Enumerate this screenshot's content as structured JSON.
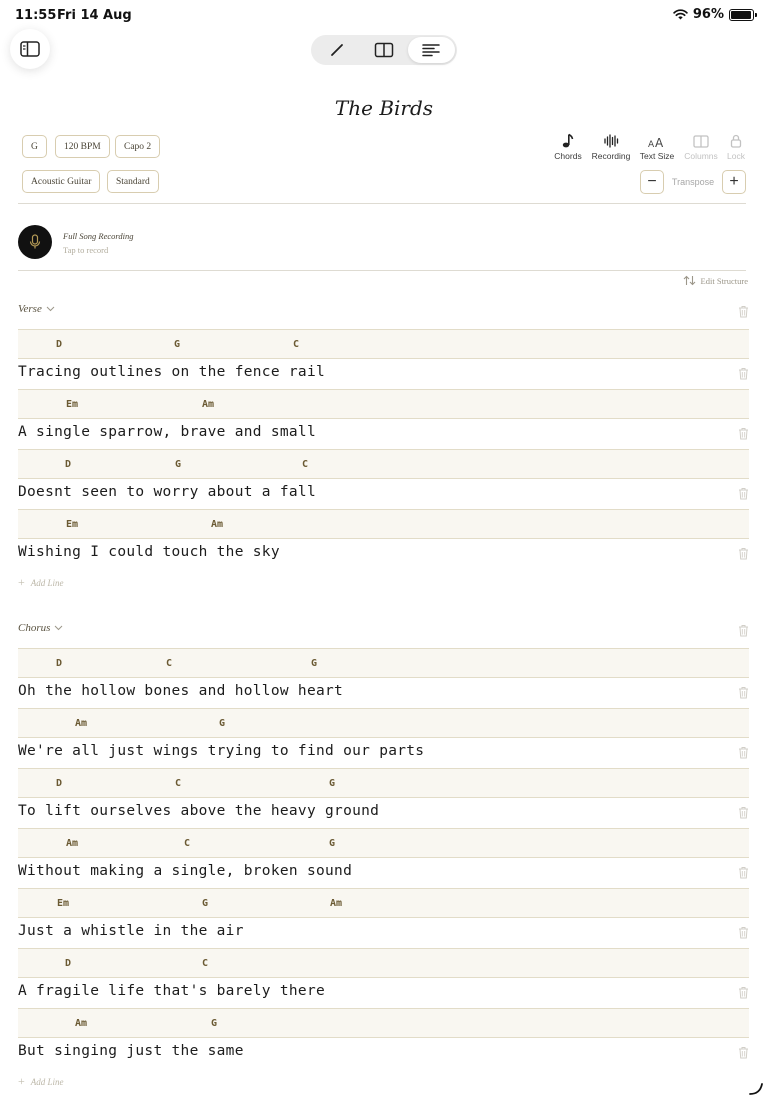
{
  "status_bar": {
    "time": "11:55",
    "date": "Fri 14 Aug",
    "battery": "96%",
    "battery_level": 0.96
  },
  "song": {
    "title": "The Birds"
  },
  "tags": {
    "key": "G",
    "tempo": "120 BPM",
    "capo": "Capo 2",
    "instrument": "Acoustic Guitar",
    "tuning": "Standard"
  },
  "tools": {
    "chords": "Chords",
    "recording": "Recording",
    "text_size": "Text Size",
    "columns": "Columns",
    "lock": "Lock",
    "transpose": "Transpose",
    "transpose_down": "−",
    "transpose_up": "+"
  },
  "recording": {
    "title": "Full Song Recording",
    "subtitle": "Tap to record"
  },
  "edit_structure": "Edit Structure",
  "add_line": "Add Line",
  "colors": {
    "chord": "#6b5a33",
    "chord_row_bg": "#f9f7f1",
    "accent_border": "#d8cdb0",
    "record_button": "#111111",
    "mic": "#b49a56"
  },
  "sections": [
    {
      "name": "Verse",
      "lines": [
        {
          "chords": [
            "D",
            "G",
            "C"
          ],
          "lyric": "Tracing outlines on the fence rail"
        },
        {
          "chords": [
            "Em",
            "Am"
          ],
          "lyric": "A single sparrow, brave and small"
        },
        {
          "chords": [
            "D",
            "G",
            "C"
          ],
          "lyric": "Doesnt seen to worry about a fall"
        },
        {
          "chords": [
            "Em",
            "Am"
          ],
          "lyric": "Wishing I could touch the sky"
        }
      ]
    },
    {
      "name": "Chorus",
      "lines": [
        {
          "chords": [
            "D",
            "C",
            "G"
          ],
          "lyric": "Oh the hollow bones and hollow heart"
        },
        {
          "chords": [
            "Am",
            "G"
          ],
          "lyric": "We're all just wings trying to find our parts"
        },
        {
          "chords": [
            "D",
            "C",
            "G"
          ],
          "lyric": "To lift ourselves above the heavy ground"
        },
        {
          "chords": [
            "Am",
            "C",
            "G"
          ],
          "lyric": "Without making a single, broken sound"
        },
        {
          "chords": [
            "Em",
            "G",
            "Am"
          ],
          "lyric": "Just a whistle in the air"
        },
        {
          "chords": [
            "D",
            "C"
          ],
          "lyric": "A fragile life that's barely there"
        },
        {
          "chords": [
            "Am",
            "G"
          ],
          "lyric": "But singing just the same"
        }
      ]
    }
  ]
}
